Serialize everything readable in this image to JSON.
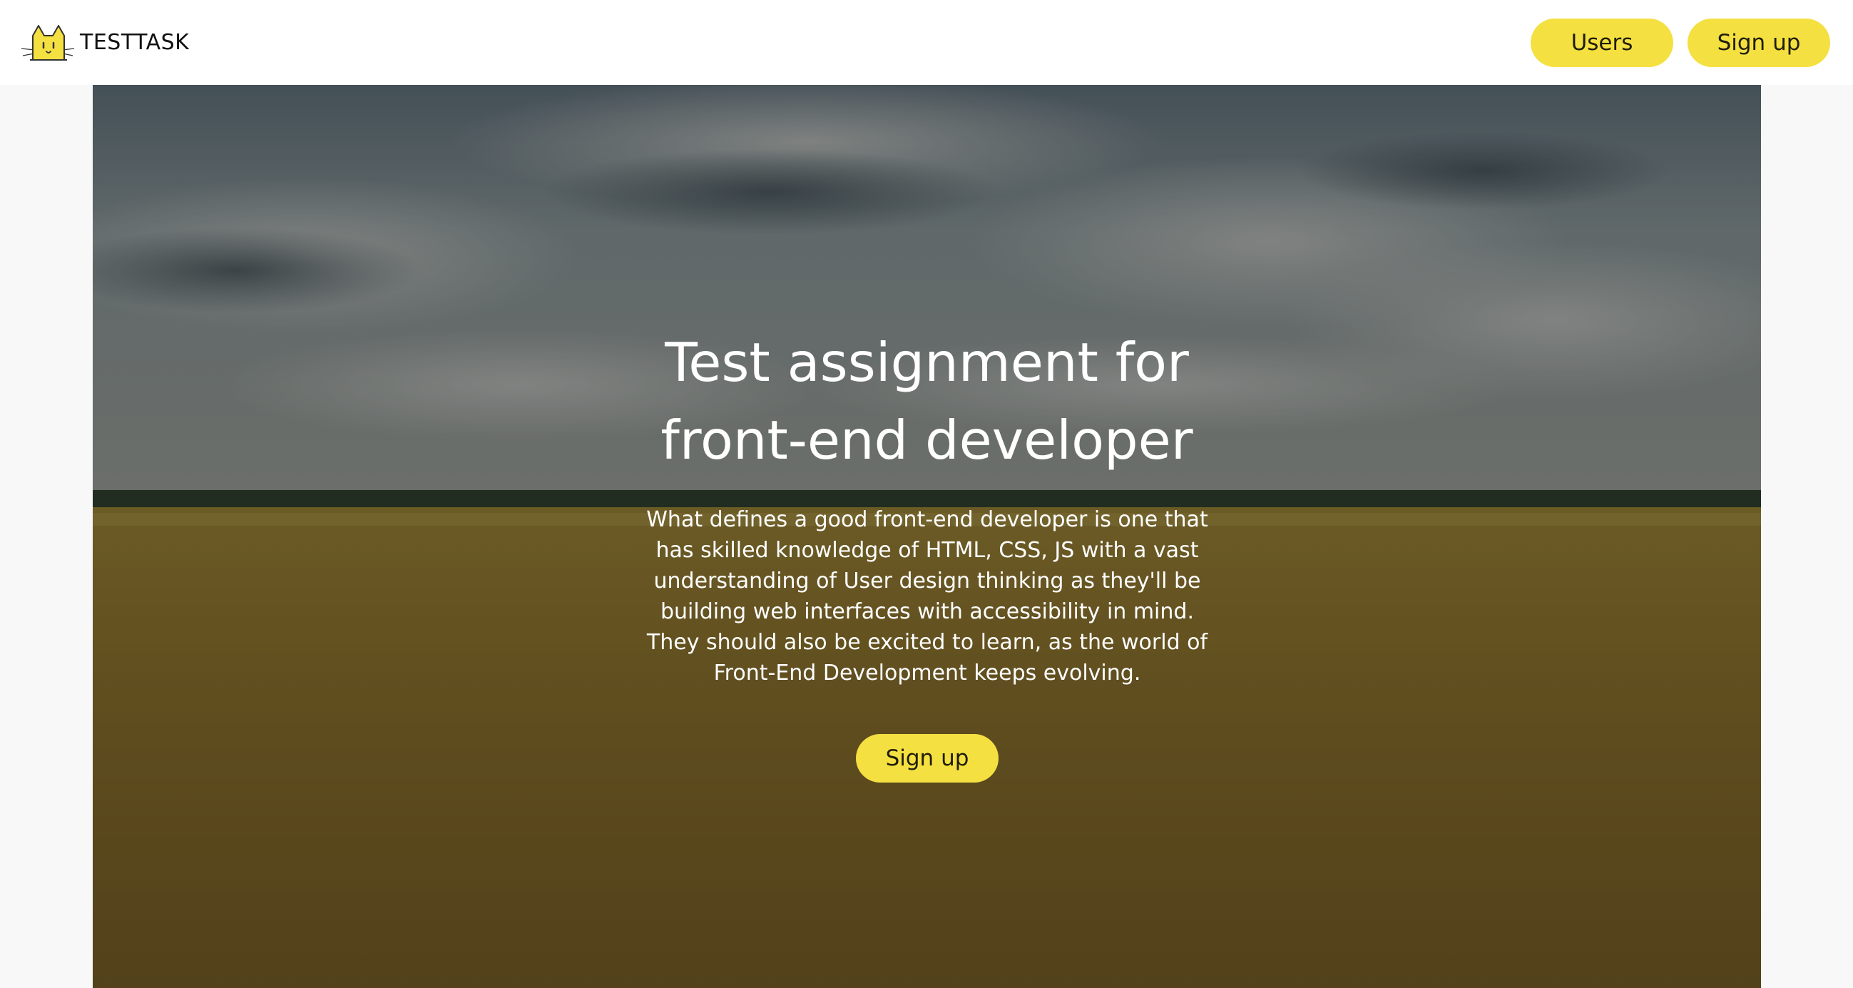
{
  "header": {
    "logo_text": "TESTTASK",
    "nav": {
      "users_label": "Users",
      "signup_label": "Sign up"
    }
  },
  "hero": {
    "title_lines": [
      "Test assignment for",
      "front-end developer"
    ],
    "text_lines": [
      "What defines a good front-end developer is one that",
      "has skilled knowledge of HTML, CSS, JS with a vast",
      "understanding of User design thinking as they'll be",
      "building web interfaces with accessibility in mind.",
      "They should also be excited to learn, as the world of",
      "Front-End Development keeps evolving."
    ],
    "button_label": "Sign up"
  },
  "colors": {
    "accent": "#f4e041",
    "header_bg": "#ffffff",
    "page_bg": "#f8f8f8",
    "hero_text": "#ffffff"
  },
  "icons": {
    "logo": "cat-logo-icon"
  }
}
